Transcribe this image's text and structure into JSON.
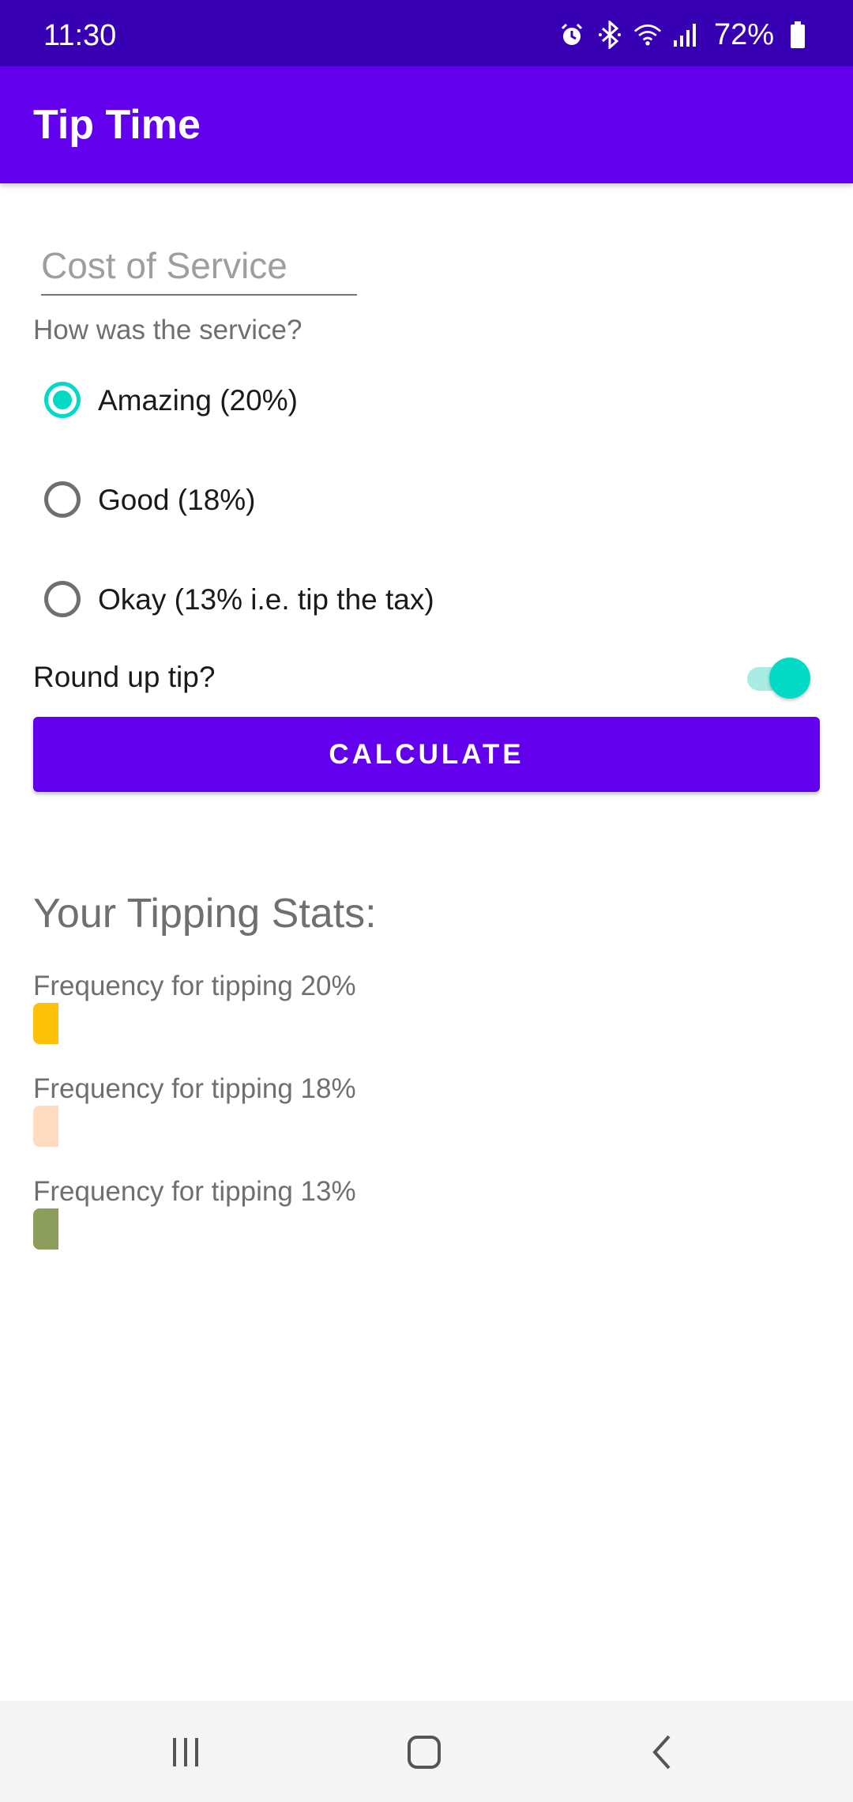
{
  "status_bar": {
    "time": "11:30",
    "battery": "72%",
    "icons": [
      "alarm-icon",
      "bluetooth-icon",
      "wifi-icon",
      "signal-icon",
      "battery-icon"
    ]
  },
  "app_bar": {
    "title": "Tip Time"
  },
  "cost_field": {
    "placeholder": "Cost of Service",
    "value": ""
  },
  "service_question": "How was the service?",
  "tip_options": [
    {
      "label": "Amazing (20%)",
      "selected": true
    },
    {
      "label": "Good (18%)",
      "selected": false
    },
    {
      "label": "Okay (13% i.e. tip the tax)",
      "selected": false
    }
  ],
  "round_up": {
    "label": "Round up tip?",
    "checked": true
  },
  "calculate_button": {
    "label": "CALCULATE"
  },
  "stats": {
    "heading": "Your Tipping Stats:",
    "items": [
      {
        "label": "Frequency for tipping 20%",
        "color": "#ffc107"
      },
      {
        "label": "Frequency for tipping 18%",
        "color": "#ffdbc2"
      },
      {
        "label": "Frequency for tipping 13%",
        "color": "#8d9d5c"
      }
    ]
  },
  "colors": {
    "status_bar": "#3700b3",
    "primary": "#6200ee",
    "accent": "#03dac5"
  },
  "nav_bar": {
    "icons": [
      "recents-icon",
      "home-icon",
      "back-icon"
    ]
  }
}
